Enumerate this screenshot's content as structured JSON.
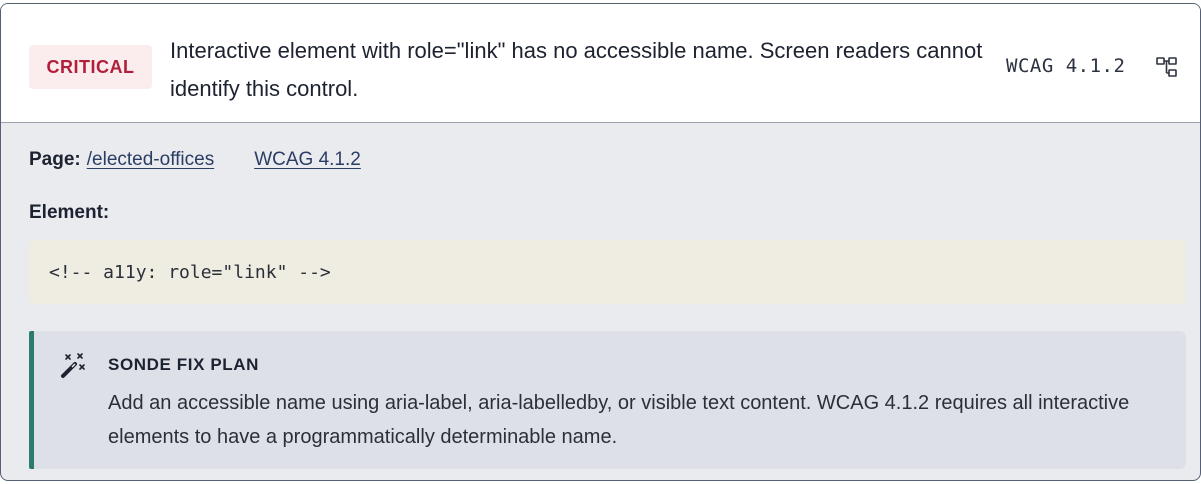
{
  "issue": {
    "severity": "CRITICAL",
    "summary": "Interactive element with role=\"link\" has no accessible name. Screen readers cannot identify this control.",
    "wcag_tag": "WCAG 4.1.2",
    "tree_icon": "tree-structure-icon"
  },
  "details": {
    "page_label": "Page:",
    "page_link": "/elected-offices",
    "wcag_link": "WCAG 4.1.2",
    "element_label": "Element:",
    "element_code": "<!-- a11y: role=\"link\" -->"
  },
  "fix_plan": {
    "icon": "magic-wand-icon",
    "title": "SONDE FIX PLAN",
    "text": "Add an accessible name using aria-label, aria-labelledby, or visible text content. WCAG 4.1.2 requires all interactive elements to have a programmatically determinable name."
  },
  "colors": {
    "critical_text": "#b21f3b",
    "critical_bg": "#fbeced",
    "fix_accent": "#2d7a6e",
    "link": "#2b3d63"
  }
}
